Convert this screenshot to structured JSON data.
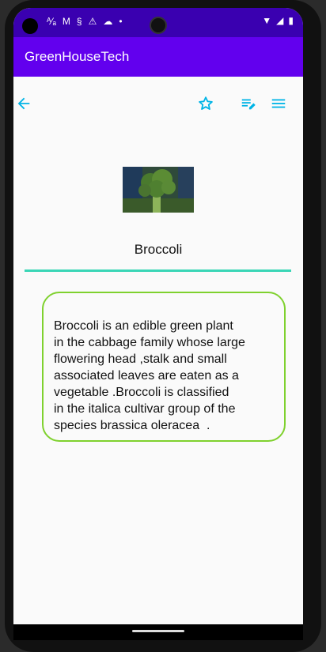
{
  "app": {
    "title": "GreenHouseTech"
  },
  "toolbar": {
    "back_icon": "arrow-back-icon",
    "star_icon": "star-outline-icon",
    "edit_icon": "edit-note-icon",
    "menu_icon": "menu-icon"
  },
  "item": {
    "name": "Broccoli",
    "description": "Broccoli is an edible green plant\nin the cabbage family whose large\nflowering head ,stalk and small\nassociated leaves are eaten as a\nvegetable .Broccoli is classified\nin the italica cultivar group of the\nspecies brassica oleracea  ."
  },
  "colors": {
    "status_bar": "#3a00b0",
    "app_bar": "#6200ee",
    "icon_accent": "#00b4e6",
    "divider": "#3ad6b6",
    "card_border": "#7fd12e"
  }
}
